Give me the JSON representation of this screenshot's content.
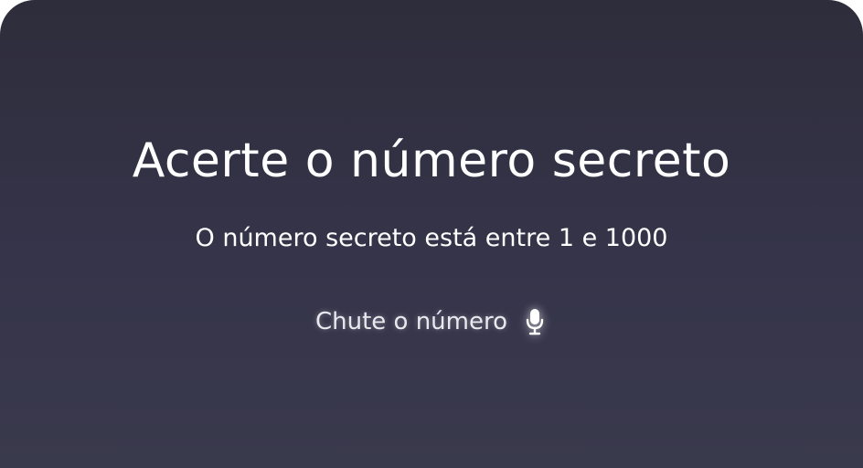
{
  "game": {
    "title": "Acerte o número secreto",
    "subtitle": "O número secreto está entre 1 e 1000",
    "voice_prompt": "Chute o número",
    "mic_icon": "microphone-icon"
  },
  "colors": {
    "background_top": "#2e2d3b",
    "background_bottom": "#3a3a4d",
    "text": "#ffffff"
  }
}
